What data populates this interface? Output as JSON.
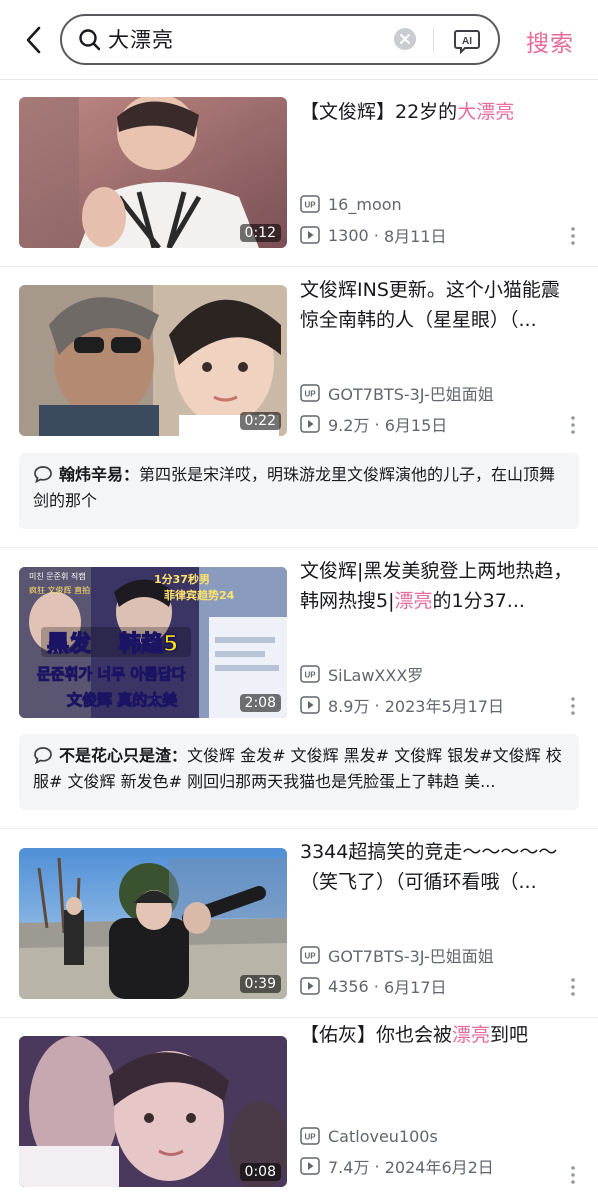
{
  "header": {
    "search_query": "大漂亮",
    "search_button": "搜索",
    "ai_label": "AI"
  },
  "videos": [
    {
      "title_parts": [
        "【文俊辉】22岁的",
        "大漂亮",
        ""
      ],
      "duration": "0:12",
      "uploader": "16_moon",
      "views": "1300",
      "date": "8月11日"
    },
    {
      "title_parts": [
        "文俊辉INS更新。这个小猫能震惊全南韩的人（星星眼）（...",
        "",
        ""
      ],
      "duration": "0:22",
      "uploader": "GOT7BTS-3J-巴姐面姐",
      "views": "9.2万",
      "date": "6月15日",
      "comment": {
        "user": "翰炜辛易：",
        "text": "第四张是宋洋哎，明珠游龙里文俊辉演他的儿子，在山顶舞剑的那个"
      }
    },
    {
      "title_parts": [
        "文俊辉|黑发美貌登上两地热趋，韩网热搜5|",
        "漂亮",
        "的1分37..."
      ],
      "duration": "2:08",
      "uploader": "SiLawXXX罗",
      "views": "8.9万",
      "date": "2023年5月17日",
      "thumb_text": {
        "top_korean": "미친 문준휘 직캠",
        "badge_tags": "疯狂  文俊辉  直拍",
        "time_stat": "1分37秒男",
        "trend": "菲律宾趋势24",
        "black_hair": "黑发",
        "hot": "韩趋5",
        "korean": "문준휘가 너무 아름답다",
        "bottom": "文俊辉  真的太美"
      },
      "comment": {
        "user": "不是花心只是渣：",
        "text": "文俊辉 金发# 文俊辉 黑发# 文俊辉 银发#文俊辉 校服# 文俊辉 新发色# 刚回归那两天我猫也是凭脸蛋上了韩趋 美..."
      }
    },
    {
      "title_parts": [
        "3344超搞笑的竞走～～～～～（笑飞了）（可循环看哦（...",
        "",
        ""
      ],
      "duration": "0:39",
      "uploader": "GOT7BTS-3J-巴姐面姐",
      "views": "4356",
      "date": "6月17日"
    },
    {
      "title_parts": [
        "【佑灰】你也会被",
        "漂亮",
        "到吧"
      ],
      "duration": "0:08",
      "uploader": "Catloveu100s",
      "views": "7.4万",
      "date": "2024年6月2日"
    }
  ],
  "colors": {
    "accent": "#e86a9b",
    "meta_gray": "#61666d",
    "comment_bg": "#f4f5f7"
  },
  "icons": {
    "back": "chevron-left-icon",
    "search": "search-icon",
    "clear": "clear-icon",
    "ai": "ai-icon",
    "uploader": "up-badge-icon",
    "views": "play-count-icon",
    "more": "more-vertical-icon",
    "comment": "comment-bubble-icon"
  }
}
